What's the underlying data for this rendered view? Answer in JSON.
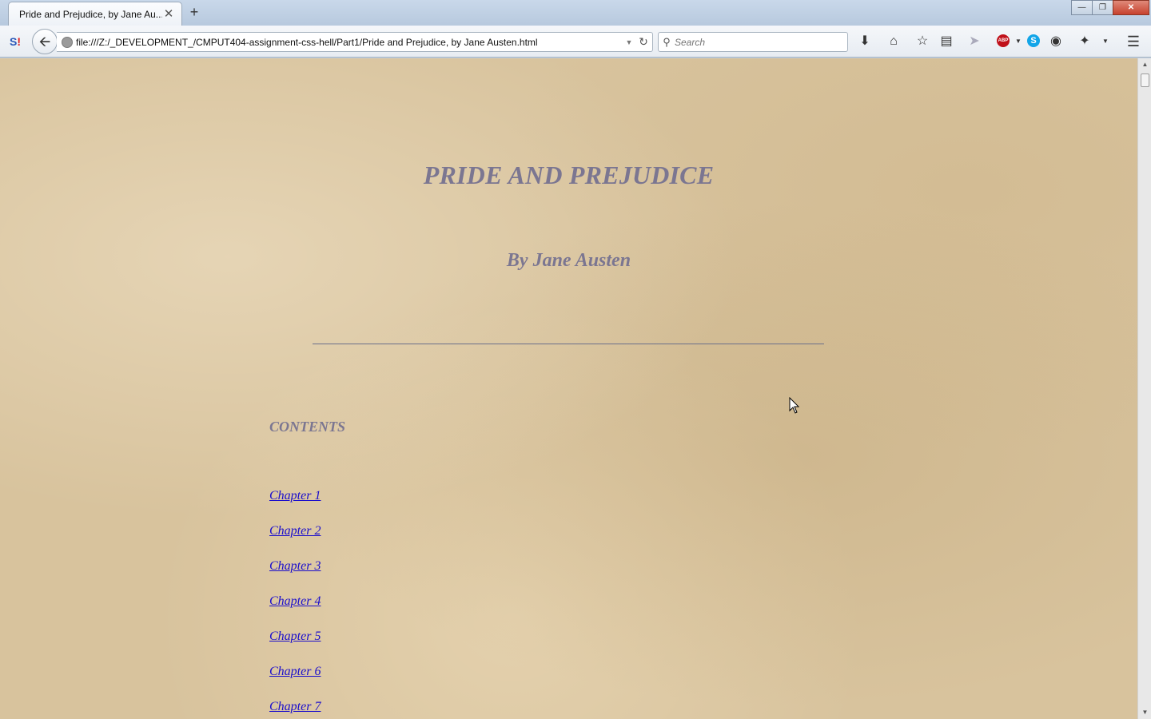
{
  "browser": {
    "tab": {
      "title": "Pride and Prejudice, by Jane Au...",
      "close_glyph": "✕"
    },
    "new_tab_glyph": "+",
    "window_controls": {
      "minimize": "—",
      "restore": "❐",
      "close": "✕"
    },
    "address": {
      "url": "file:///Z:/_DEVELOPMENT_/CMPUT404-assignment-css-hell/Part1/Pride and Prejudice, by Jane Austen.html"
    },
    "search": {
      "placeholder": "Search"
    },
    "toolbar_icons": [
      "download-icon",
      "home-icon",
      "bookmark-star-icon",
      "reading-list-icon",
      "send-icon",
      "adblock-icon",
      "skype-icon",
      "ghostery-icon",
      "extension-icon",
      "menu-icon"
    ],
    "adblock_label": "ABP",
    "skype_label": "S"
  },
  "page": {
    "title": "PRIDE AND PREJUDICE",
    "author": "By Jane Austen",
    "contents_heading": "CONTENTS",
    "chapters": [
      "Chapter 1",
      "Chapter 2",
      "Chapter 3",
      "Chapter 4",
      "Chapter 5",
      "Chapter 6",
      "Chapter 7"
    ]
  },
  "colors": {
    "heading": "#7b7691",
    "link": "#1a0dcc",
    "background": "#d8c39d"
  }
}
